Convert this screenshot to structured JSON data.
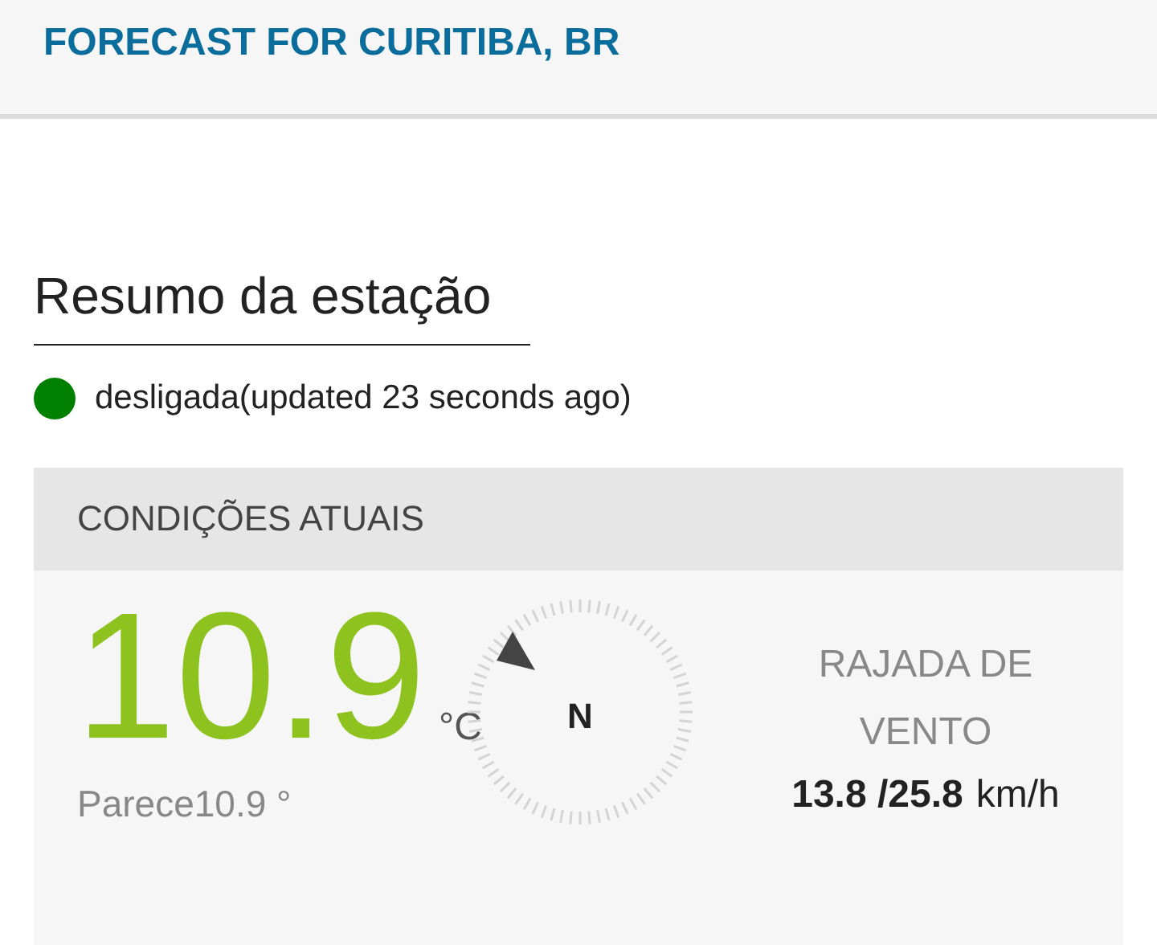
{
  "header": {
    "title": "FORECAST FOR CURITIBA, BR"
  },
  "station": {
    "heading": "Resumo da estação",
    "status": {
      "color": "#008000",
      "text": "desligada(updated 23 seconds ago)"
    }
  },
  "conditions": {
    "title": "CONDIÇÕES ATUAIS",
    "temperature": "10.9",
    "unit": "°C",
    "feels_like": "Parece10.9 °",
    "compass_label": "N",
    "wind_title": "RAJADA DE VENTO",
    "wind_value": "13.8 /25.8",
    "wind_unit": "km/h"
  }
}
